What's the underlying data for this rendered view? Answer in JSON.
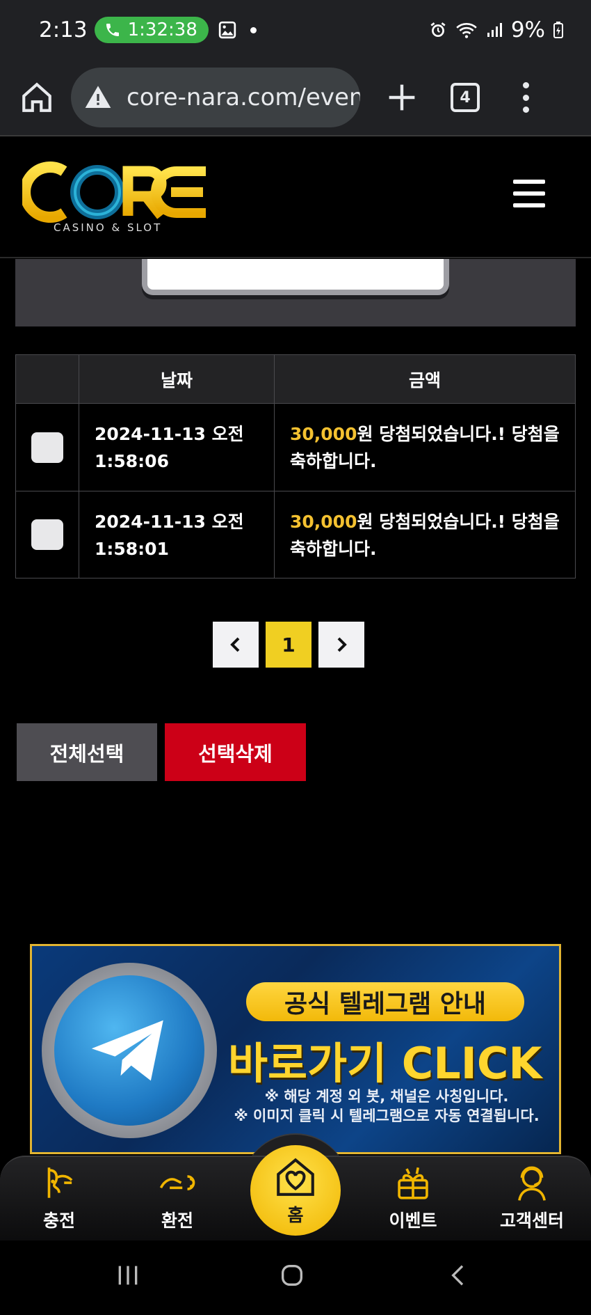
{
  "status_bar": {
    "time": "2:13",
    "call_timer": "1:32:38",
    "battery": "9%"
  },
  "browser": {
    "url": "core-nara.com/event",
    "tab_count": "4"
  },
  "site": {
    "logo_text": "CORE",
    "logo_subtext": "CASINO & SLOT"
  },
  "table": {
    "headers": [
      "",
      "날짜",
      "금액"
    ],
    "rows": [
      {
        "date": "2024-11-13 오전 1:58:06",
        "amount": "30,000",
        "message": "원 당첨되었습니다.! 당첨을 축하합니다."
      },
      {
        "date": "2024-11-13 오전 1:58:01",
        "amount": "30,000",
        "message": "원 당첨되었습니다.! 당첨을 축하합니다."
      }
    ]
  },
  "pagination": {
    "current_page": "1"
  },
  "actions": {
    "select_all": "전체선택",
    "delete_selected": "선택삭제"
  },
  "banner": {
    "pill_text": "공식 텔레그램 안내",
    "cta_text": "바로가기 CLICK",
    "note_line1": "※ 해당 계정 외 봇, 채널은 사칭입니다.",
    "note_line2": "※ 이미지 클릭 시 텔레그램으로 자동 연결됩니다."
  },
  "bottom_nav": {
    "items": [
      {
        "label": "충전",
        "icon": "deposit-icon"
      },
      {
        "label": "환전",
        "icon": "withdraw-icon"
      },
      {
        "label": "홈",
        "icon": "home-heart-icon"
      },
      {
        "label": "이벤트",
        "icon": "gift-icon"
      },
      {
        "label": "고객센터",
        "icon": "support-agent-icon"
      }
    ]
  },
  "colors": {
    "accent_yellow": "#f0cf22",
    "amount_gold": "#f4c130",
    "delete_red": "#cc0017"
  }
}
